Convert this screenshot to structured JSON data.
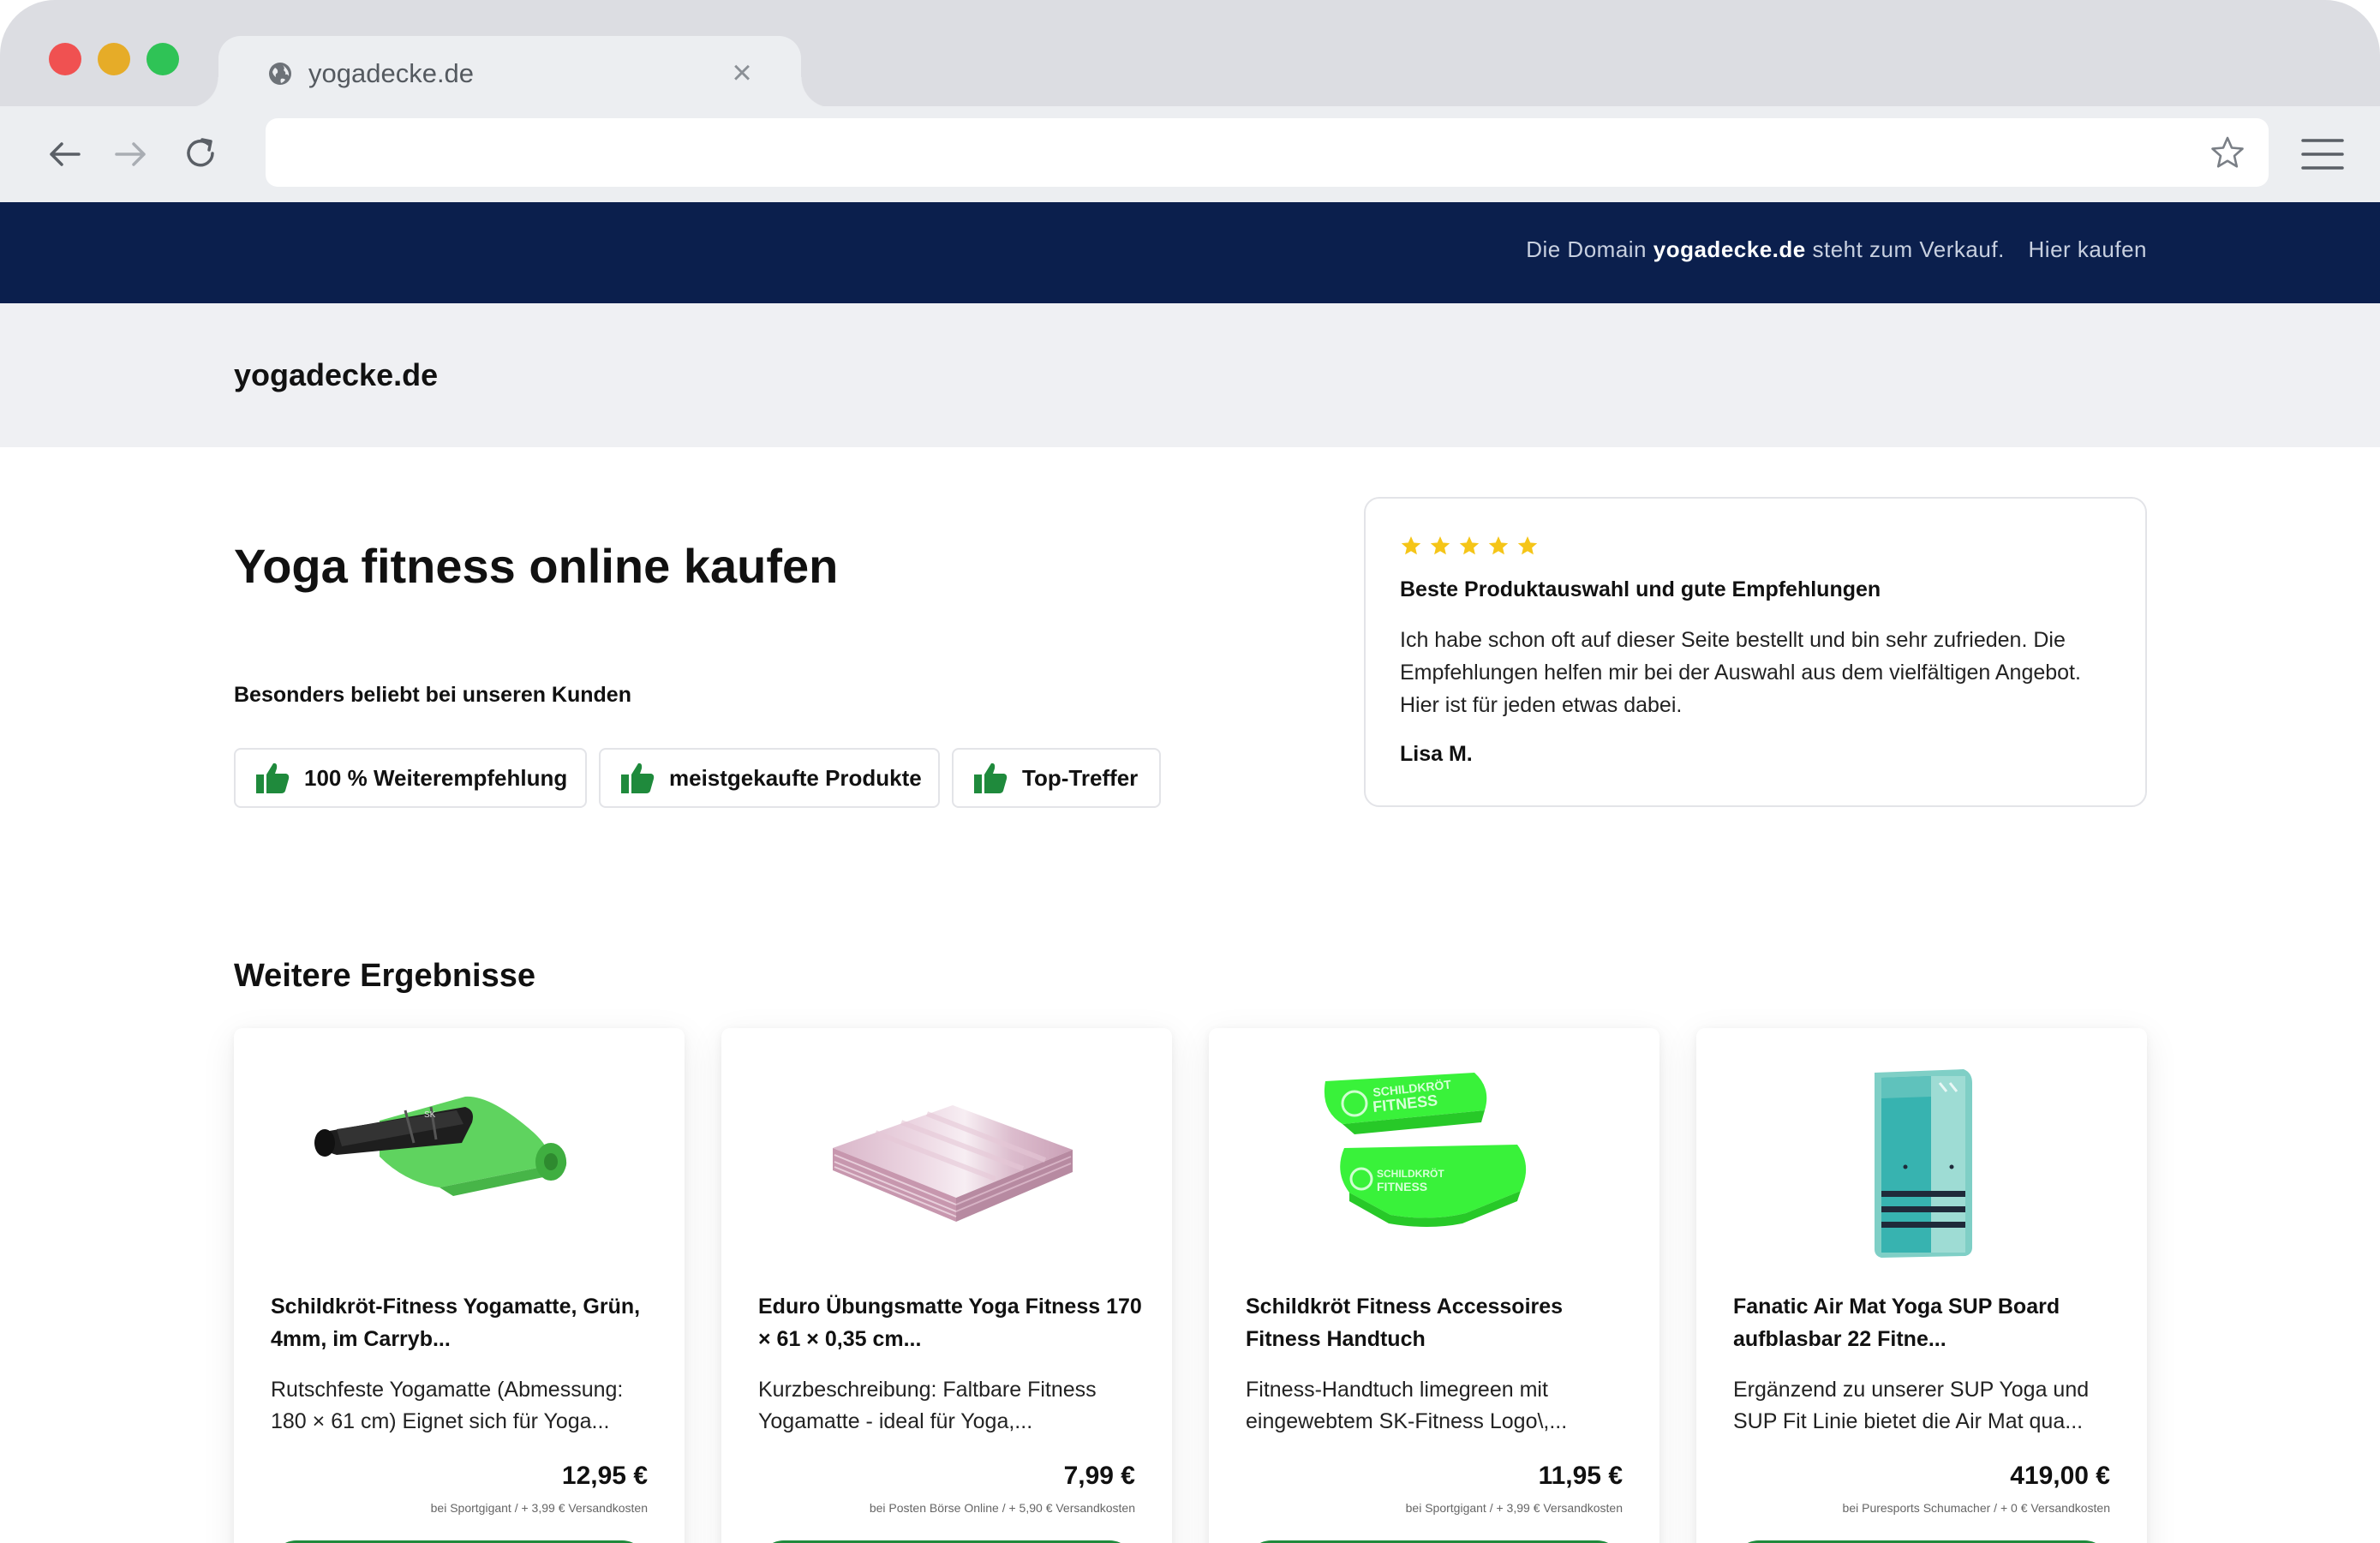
{
  "browser": {
    "tab_title": "yogadecke.de",
    "tab_close": "×",
    "url": ""
  },
  "promo": {
    "prefix": "Die Domain",
    "domain": "yogadecke.de",
    "suffix": "steht zum Verkauf.",
    "link": "Hier kaufen"
  },
  "site": {
    "logo": "yogadecke.de"
  },
  "hero": {
    "title_light": "Yoga fitness",
    "title_bold": "online kaufen",
    "popular_label": "Besonders beliebt bei unseren Kunden",
    "badges": [
      {
        "label": "100 % Weiterempfehlung"
      },
      {
        "label": "meistgekaufte Produkte"
      },
      {
        "label": "Top-Treffer"
      }
    ]
  },
  "review": {
    "rating": 5,
    "title": "Beste Produktauswahl und gute Empfehlungen",
    "text": "Ich habe schon oft auf dieser Seite bestellt und bin sehr zufrieden. Die Empfehlungen helfen mir bei der Auswahl aus dem vielfältigen Angebot. Hier ist für jeden etwas dabei.",
    "author": "Lisa M."
  },
  "results": {
    "title": "Weitere Ergebnisse",
    "products": [
      {
        "title": "Schildkröt-Fitness Yogamatte, Grün, 4mm, im Carryb...",
        "desc": "Rutschfeste Yogamatte (Abmessung: 180 × 61 cm) Eignet sich für Yoga...",
        "price": "12,95 €",
        "shop": "bei Sportgigant / + 3,99 € Versandkosten"
      },
      {
        "title": "Eduro Übungsmatte Yoga Fitness 170 × 61 × 0,35 cm...",
        "desc": "Kurzbeschreibung: Faltbare Fitness Yogamatte - ideal für Yoga,...",
        "price": "7,99 €",
        "shop": "bei Posten Börse Online / + 5,90 € Versandkosten"
      },
      {
        "title": "Schildkröt Fitness Accessoires Fitness Handtuch",
        "desc": "Fitness-Handtuch limegreen mit eingewebtem SK-Fitness Logo\\,...",
        "price": "11,95 €",
        "shop": "bei Sportgigant / + 3,99 € Versandkosten"
      },
      {
        "title": "Fanatic Air Mat Yoga SUP Board aufblasbar 22 Fitne...",
        "desc": "Ergänzend zu unserer SUP Yoga und SUP Fit Linie bietet die Air Mat qua...",
        "price": "419,00 €",
        "shop": "bei Puresports Schumacher / + 0 € Versandkosten"
      }
    ]
  },
  "colors": {
    "promo_bg": "#0b1f4d",
    "header_bg": "#eff0f3",
    "thumb_green": "#1f8a3c",
    "star_yellow": "#f5c518",
    "lime": "#39f23a"
  },
  "icons": {
    "tab": "globe-icon",
    "back": "arrow-left-icon",
    "forward": "arrow-right-icon",
    "reload": "reload-icon",
    "bookmark": "star-outline-icon",
    "menu": "hamburger-menu-icon",
    "badge": "thumbs-up-icon",
    "rating": "star-icon"
  }
}
